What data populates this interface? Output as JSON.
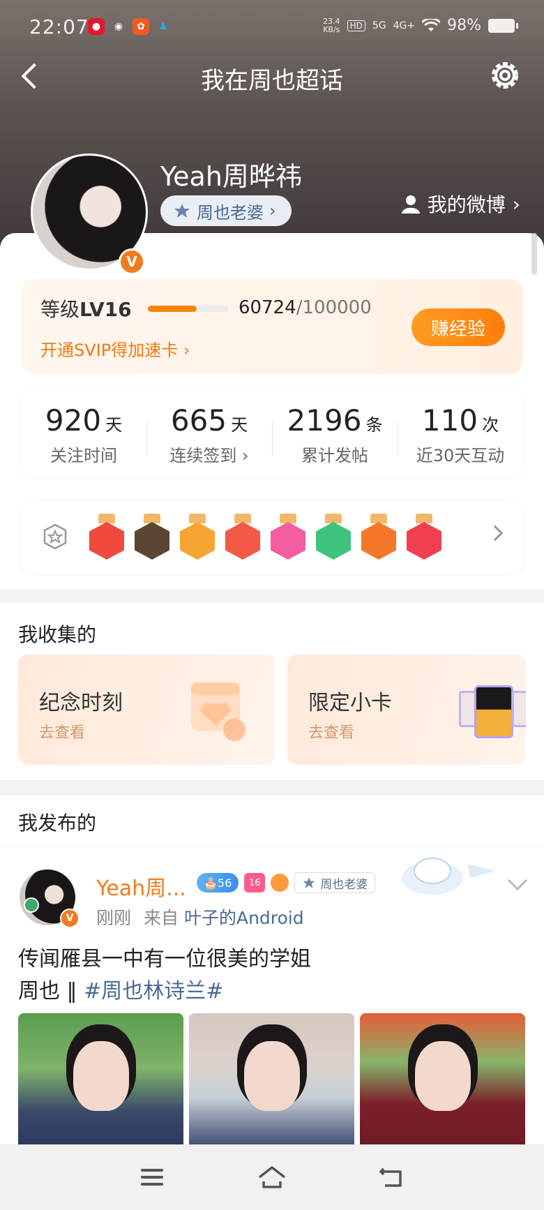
{
  "status_bar": {
    "time": "22:07",
    "network_speed": "23.4",
    "network_unit": "KB/s",
    "hd_tag": "HD",
    "signal_5g": "5G",
    "signal_4g": "4G+",
    "battery": "98%"
  },
  "header": {
    "title": "我在周也超话"
  },
  "profile": {
    "username": "Yeah周晔祎",
    "title_tag": "周也老婆",
    "my_weibo": "我的微博",
    "verified_mark": "V"
  },
  "level": {
    "label": "等级",
    "level": "LV16",
    "exp_current": "60724",
    "exp_max": "/100000",
    "progress": 0.607,
    "svip_link": "开通SVIP得加速卡",
    "earn_button": "赚经验"
  },
  "stats": [
    {
      "value": "920",
      "unit": "天",
      "label": "关注时间"
    },
    {
      "value": "665",
      "unit": "天",
      "label": "连续签到"
    },
    {
      "value": "2196",
      "unit": "条",
      "label": "累计发帖"
    },
    {
      "value": "110",
      "unit": "次",
      "label": "近30天互动"
    }
  ],
  "badges": {
    "items": [
      {
        "icon": "fox-badge-icon",
        "color": "#f04a3e"
      },
      {
        "icon": "super-crown-badge-icon",
        "color": "#5a4632"
      },
      {
        "icon": "crown-badge-icon",
        "color": "#f6a532"
      },
      {
        "icon": "cat-badge-icon",
        "color": "#f25a45"
      },
      {
        "icon": "lv16-badge-icon",
        "color": "#f45da0"
      },
      {
        "icon": "hand-badge-icon",
        "color": "#3fc37c"
      },
      {
        "icon": "100-days-badge-icon",
        "color": "#f5782a"
      },
      {
        "icon": "trophy-badge-icon",
        "color": "#f0404f"
      }
    ]
  },
  "collected": {
    "title": "我收集的",
    "cards": [
      {
        "title": "纪念时刻",
        "link": "去查看"
      },
      {
        "title": "限定小卡",
        "link": "去查看"
      }
    ]
  },
  "published": {
    "title": "我发布的",
    "post": {
      "author": "Yeah周...",
      "level_tag": "56",
      "gem_tag": "16",
      "title_tag": "周也老婆",
      "time": "刚刚",
      "from_label": "来自",
      "source": "叶子的Android",
      "text_line1": "传闻雁县一中有一位很美的学姐",
      "text_line2": "周也 ‖ ",
      "topic": "#周也林诗兰#"
    }
  },
  "colors": {
    "accent": "#f7850f",
    "link_blue": "#4a6a95",
    "verified": "#f07b1e"
  }
}
